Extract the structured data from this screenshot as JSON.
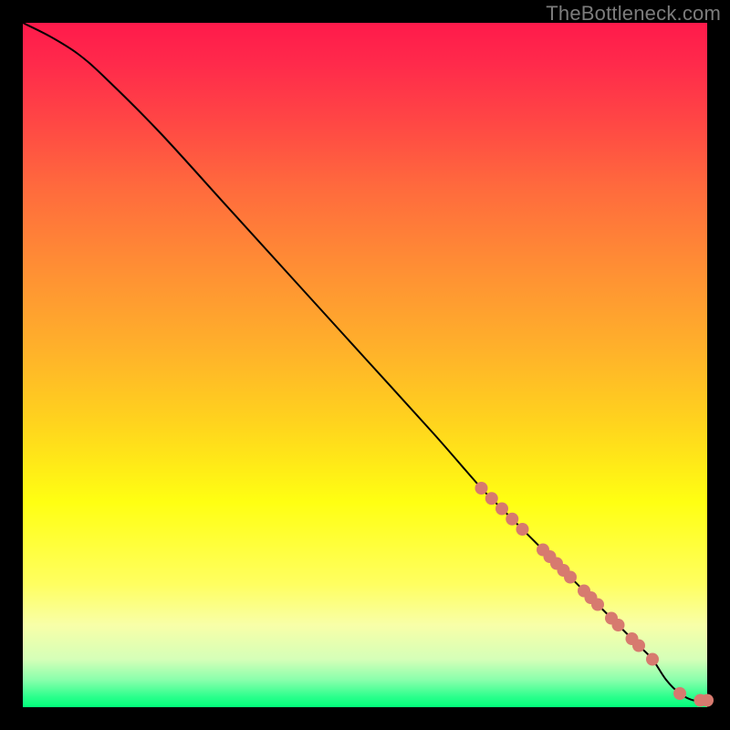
{
  "watermark": {
    "text": "TheBottleneck.com"
  },
  "colors": {
    "background": "#000000",
    "curve": "#000000",
    "marker": "#d77a6f",
    "gradient_top": "#ff1a4b",
    "gradient_bottom": "#00ff7a"
  },
  "chart_data": {
    "type": "line",
    "title": "",
    "xlabel": "",
    "ylabel": "",
    "xlim": [
      0,
      100
    ],
    "ylim": [
      0,
      100
    ],
    "grid": false,
    "legend": false,
    "series": [
      {
        "name": "curve",
        "x": [
          0,
          4,
          8,
          12,
          20,
          30,
          40,
          50,
          60,
          67,
          70,
          73,
          76,
          78,
          80,
          82,
          84,
          86,
          88,
          90,
          92,
          94,
          96,
          98,
          100
        ],
        "y": [
          100,
          98,
          95.5,
          92,
          84,
          73,
          62,
          51,
          40,
          32,
          29,
          26,
          23,
          21,
          19,
          17,
          15,
          13,
          11,
          9,
          7,
          4,
          2,
          1,
          1
        ]
      }
    ],
    "markers": {
      "name": "highlight-points",
      "color": "#d77a6f",
      "radius": 7,
      "points": [
        {
          "x": 67,
          "y": 32
        },
        {
          "x": 68.5,
          "y": 30.5
        },
        {
          "x": 70,
          "y": 29
        },
        {
          "x": 71.5,
          "y": 27.5
        },
        {
          "x": 73,
          "y": 26
        },
        {
          "x": 76,
          "y": 23
        },
        {
          "x": 77,
          "y": 22
        },
        {
          "x": 78,
          "y": 21
        },
        {
          "x": 79,
          "y": 20
        },
        {
          "x": 80,
          "y": 19
        },
        {
          "x": 82,
          "y": 17
        },
        {
          "x": 83,
          "y": 16
        },
        {
          "x": 84,
          "y": 15
        },
        {
          "x": 86,
          "y": 13
        },
        {
          "x": 87,
          "y": 12
        },
        {
          "x": 89,
          "y": 10
        },
        {
          "x": 90,
          "y": 9
        },
        {
          "x": 92,
          "y": 7
        },
        {
          "x": 96,
          "y": 2
        },
        {
          "x": 99,
          "y": 1
        },
        {
          "x": 100,
          "y": 1
        }
      ]
    }
  }
}
